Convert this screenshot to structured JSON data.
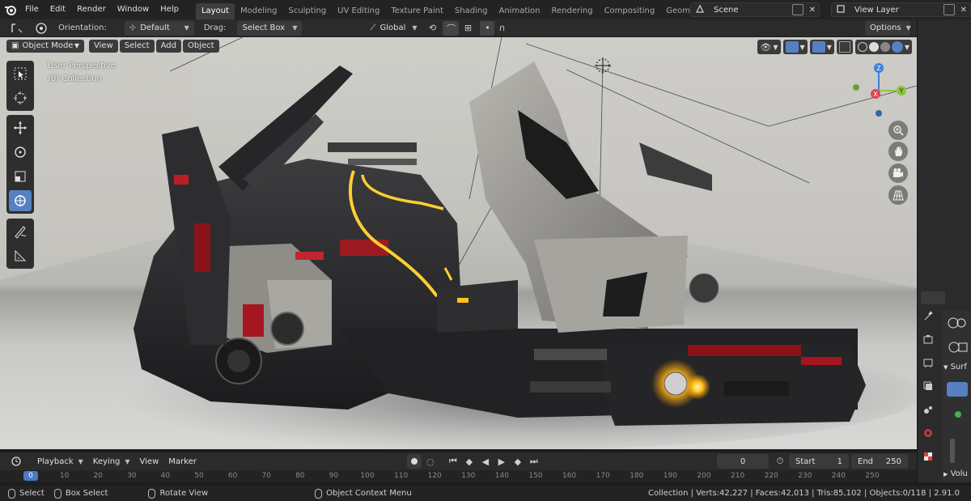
{
  "menu": {
    "items": [
      "File",
      "Edit",
      "Render",
      "Window",
      "Help"
    ]
  },
  "workspaces": [
    "Layout",
    "Modeling",
    "Sculpting",
    "UV Editing",
    "Texture Paint",
    "Shading",
    "Animation",
    "Rendering",
    "Compositing",
    "Geometry Nod"
  ],
  "scene": {
    "name": "Scene"
  },
  "view_layer": {
    "name": "View Layer"
  },
  "header": {
    "orientation_label": "Orientation:",
    "orientation_value": "Default",
    "drag_label": "Drag:",
    "drag_value": "Select Box",
    "transform_orientation": "Global",
    "options_label": "Options"
  },
  "viewport": {
    "mode": "Object Mode",
    "menus": [
      "View",
      "Select",
      "Add",
      "Object"
    ],
    "perspective": "User Perspective",
    "collection": "(0) Collection",
    "gizmo_axes": {
      "x": "X",
      "y": "Y",
      "z": "Z"
    }
  },
  "colors": {
    "accent": "#5680c2",
    "axis_x": "#e0434f",
    "axis_y": "#8cc63f",
    "axis_z": "#3d82d9",
    "active_tab": "#3d3d3d",
    "glow": "#ffc21a"
  },
  "right_panel": {
    "tab_label": "Surf",
    "section_label": "Volu"
  },
  "timeline": {
    "menus": [
      "Playback",
      "Keying",
      "View",
      "Marker"
    ],
    "current_frame": "0",
    "start_label": "Start",
    "start_value": "1",
    "end_label": "End",
    "end_value": "250",
    "ruler_labels": [
      "0",
      "10",
      "20",
      "30",
      "40",
      "50",
      "60",
      "70",
      "80",
      "90",
      "100",
      "110",
      "120",
      "130",
      "140",
      "150",
      "160",
      "170",
      "180",
      "190",
      "200",
      "210",
      "220",
      "230",
      "240",
      "250"
    ]
  },
  "status": {
    "select": "Select",
    "box_select": "Box Select",
    "rotate_view": "Rotate View",
    "context_menu": "Object Context Menu",
    "stats": "Collection | Verts:42,227 | Faces:42,013 | Tris:85,102 | Objects:0/118 | 2.91.0"
  }
}
